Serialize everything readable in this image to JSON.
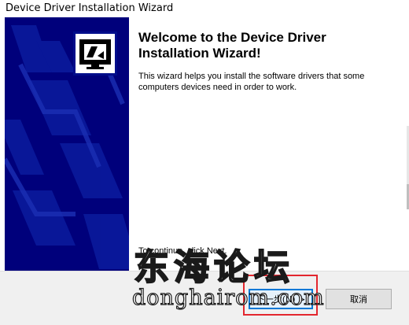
{
  "window": {
    "title": "Device Driver Installation Wizard"
  },
  "banner": {
    "icon": "device-install-icon",
    "background": "#00007b"
  },
  "content": {
    "heading": "Welcome to the Device Driver Installation Wizard!",
    "intro": "This wizard helps you install the software drivers that some computers devices need in order to work.",
    "continue_text": "To continue, click Next."
  },
  "buttons": {
    "next_label": "下一步(N) >",
    "cancel_label": "取消"
  },
  "watermark": {
    "chinese": "东海论坛",
    "site": "donghairom.com"
  },
  "colors": {
    "highlight": "#e3262e",
    "focus_border": "#0078d7"
  }
}
